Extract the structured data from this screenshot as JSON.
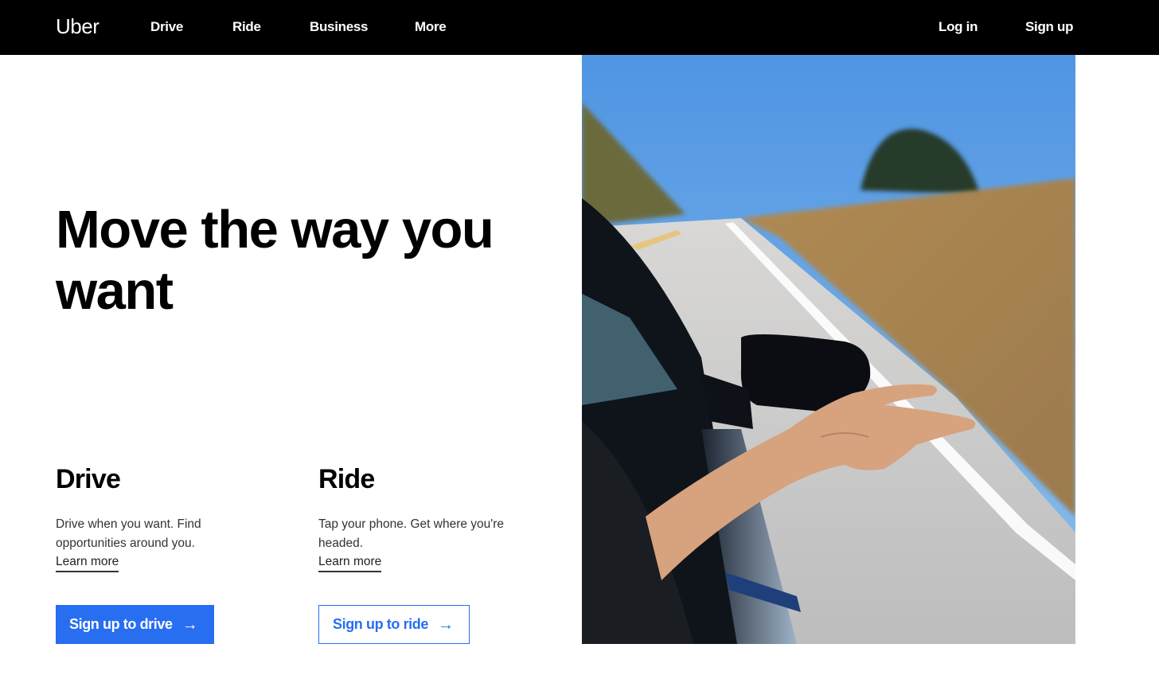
{
  "nav": {
    "logo": "Uber",
    "links": [
      {
        "label": "Drive"
      },
      {
        "label": "Ride"
      },
      {
        "label": "Business"
      },
      {
        "label": "More"
      }
    ],
    "login": "Log in",
    "signup": "Sign up"
  },
  "hero": {
    "title": "Move the way you want",
    "image_alt": "Hand out of a car window on a sunny coastal road"
  },
  "sections": [
    {
      "heading": "Drive",
      "description": "Drive when you want. Find opportunities around you.",
      "link": "Learn more",
      "button": "Sign up to drive",
      "arrow_icon": "→"
    },
    {
      "heading": "Ride",
      "description": "Tap your phone. Get where you're headed.",
      "link": "Learn more",
      "button": "Sign up to ride",
      "arrow_icon": "→"
    }
  ],
  "colors": {
    "nav_bg": "#000000",
    "accent": "#276ef1"
  }
}
